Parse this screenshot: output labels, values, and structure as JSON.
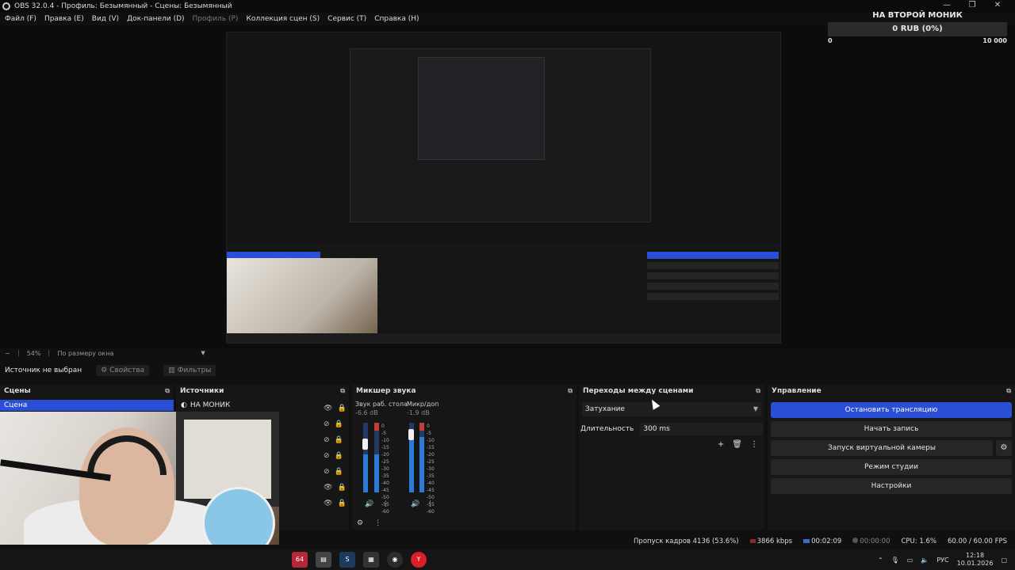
{
  "window": {
    "title": "OBS 32.0.4 - Профиль: Безымянный - Сцены: Безымянный",
    "controls": [
      "—",
      "❐",
      "✕"
    ]
  },
  "menu": {
    "items": [
      "Файл (F)",
      "Правка (E)",
      "Вид (V)",
      "Док-панели (D)",
      "Профиль (P)",
      "Коллекция сцен (S)",
      "Сервис (T)",
      "Справка (H)"
    ]
  },
  "donation_widget": {
    "title": "НА ВТОРОЙ МОНИК",
    "amount": "0 RUB (0%)",
    "min": "0",
    "max": "10 000"
  },
  "zoom": {
    "value": "54%",
    "mode": "По размеру окна"
  },
  "source_toolbar": {
    "no_source": "Источник не выбран",
    "properties": "Свойства",
    "filters": "Фильтры"
  },
  "scenes": {
    "header": "Сцены",
    "items": [
      "Сцена"
    ]
  },
  "sources": {
    "header": "Источники",
    "items": [
      "НА МОНИК"
    ]
  },
  "mixer": {
    "header": "Микшер звука",
    "channels": [
      {
        "name": "Звук раб. стола",
        "db": "-6.6 dB",
        "level": 0.55
      },
      {
        "name": "Микр/доп",
        "db": "-1.9 dB",
        "level": 0.8
      }
    ],
    "scale": [
      "0",
      "-5",
      "-10",
      "-15",
      "-20",
      "-25",
      "-30",
      "-35",
      "-40",
      "-45",
      "-50",
      "-55",
      "-60"
    ]
  },
  "transitions": {
    "header": "Переходы между сценами",
    "selected": "Затухание",
    "duration_label": "Длительность",
    "duration_value": "300 ms"
  },
  "controls": {
    "header": "Управление",
    "stop_stream": "Остановить трансляцию",
    "start_record": "Начать запись",
    "virtual_cam": "Запуск виртуальной камеры",
    "studio_mode": "Режим студии",
    "settings": "Настройки"
  },
  "status": {
    "dropped_frames": "Пропуск кадров 4136 (53.6%)",
    "bitrate": "3866 kbps",
    "stream_time": "00:02:09",
    "record_time": "00:00:00",
    "cpu": "CPU: 1.6%",
    "fps": "60.00 / 60.00 FPS"
  },
  "taskbar": {
    "lang": "РУС",
    "time": "12:18",
    "date": "10.01.2026",
    "app_badge": "64"
  },
  "colors": {
    "accent": "#2a4ed6"
  }
}
